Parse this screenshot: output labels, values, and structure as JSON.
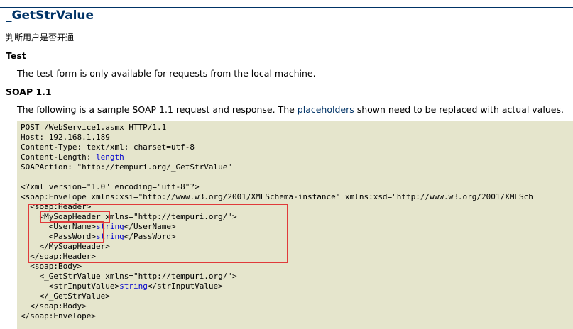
{
  "header": {
    "title": "_GetStrValue",
    "description": "判断用户是否开通"
  },
  "test_section": {
    "heading": "Test",
    "text": "The test form is only available for requests from the local machine."
  },
  "soap11_section": {
    "heading": "SOAP 1.1",
    "intro_before": "The following is a sample SOAP 1.1 request and response. The ",
    "intro_link": "placeholders",
    "intro_after": " shown need to be replaced with actual values."
  },
  "code_lines": [
    {
      "indent": "",
      "text": "POST /WebService1.asmx HTTP/1.1",
      "placeholder": "",
      "suffix": ""
    },
    {
      "indent": "",
      "text": "Host: 192.168.1.189",
      "placeholder": "",
      "suffix": ""
    },
    {
      "indent": "",
      "text": "Content-Type: text/xml; charset=utf-8",
      "placeholder": "",
      "suffix": ""
    },
    {
      "indent": "",
      "text": "Content-Length: ",
      "placeholder": "length",
      "suffix": ""
    },
    {
      "indent": "",
      "text": "SOAPAction: \"http://tempuri.org/_GetStrValue\"",
      "placeholder": "",
      "suffix": ""
    },
    {
      "indent": "",
      "text": "",
      "placeholder": "",
      "suffix": ""
    },
    {
      "indent": "",
      "text": "<?xml version=\"1.0\" encoding=\"utf-8\"?>",
      "placeholder": "",
      "suffix": ""
    },
    {
      "indent": "",
      "text": "<soap:Envelope xmlns:xsi=\"http://www.w3.org/2001/XMLSchema-instance\" xmlns:xsd=\"http://www.w3.org/2001/XMLSch",
      "placeholder": "",
      "suffix": ""
    },
    {
      "indent": "  ",
      "text": "<soap:Header>",
      "placeholder": "",
      "suffix": ""
    },
    {
      "indent": "    ",
      "text": "<MySoapHeader xmlns=\"http://tempuri.org/\">",
      "placeholder": "",
      "suffix": ""
    },
    {
      "indent": "      ",
      "text": "<UserName>",
      "placeholder": "string",
      "suffix": "</UserName>"
    },
    {
      "indent": "      ",
      "text": "<PassWord>",
      "placeholder": "string",
      "suffix": "</PassWord>"
    },
    {
      "indent": "    ",
      "text": "</MySoapHeader>",
      "placeholder": "",
      "suffix": ""
    },
    {
      "indent": "  ",
      "text": "</soap:Header>",
      "placeholder": "",
      "suffix": ""
    },
    {
      "indent": "  ",
      "text": "<soap:Body>",
      "placeholder": "",
      "suffix": ""
    },
    {
      "indent": "    ",
      "text": "<_GetStrValue xmlns=\"http://tempuri.org/\">",
      "placeholder": "",
      "suffix": ""
    },
    {
      "indent": "      ",
      "text": "<strInputValue>",
      "placeholder": "string",
      "suffix": "</strInputValue>"
    },
    {
      "indent": "    ",
      "text": "</_GetStrValue>",
      "placeholder": "",
      "suffix": ""
    },
    {
      "indent": "  ",
      "text": "</soap:Body>",
      "placeholder": "",
      "suffix": ""
    },
    {
      "indent": "",
      "text": "</soap:Envelope>",
      "placeholder": "",
      "suffix": ""
    }
  ],
  "colors": {
    "title": "#003366",
    "link": "#003366",
    "code_background": "#e5e5cc",
    "placeholder_text": "#0000cc",
    "annotation_box": "#e03a3a"
  }
}
